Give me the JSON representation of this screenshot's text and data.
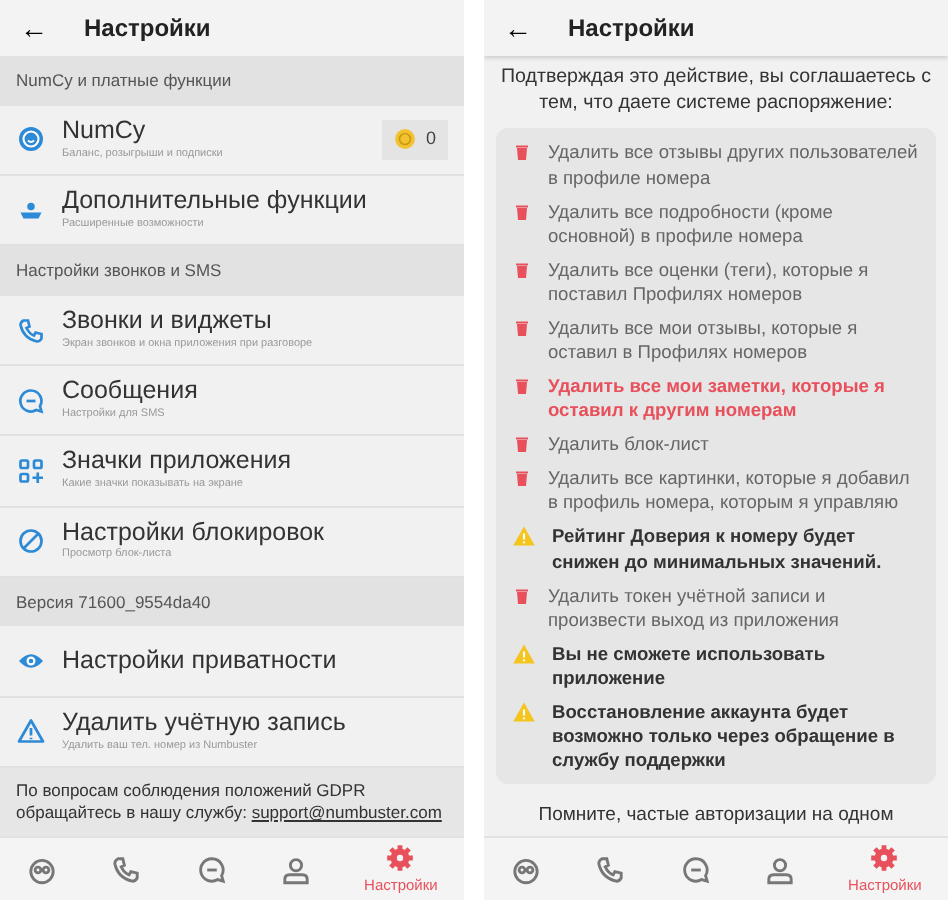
{
  "left": {
    "header": {
      "back": "←",
      "title": "Настройки"
    },
    "sections": [
      {
        "kind": "label",
        "text": "NumCy и платные функции"
      },
      {
        "kind": "row",
        "title": "NumCy",
        "subtitle": "Баланс, розыгрыши и подписки",
        "badge": "0"
      },
      {
        "kind": "row",
        "title": "Дополнительные функции",
        "subtitle": "Расширенные возможности"
      },
      {
        "kind": "label",
        "text": "Настройки звонков и SMS"
      },
      {
        "kind": "row",
        "title": "Звонки и виджеты",
        "subtitle": "Экран звонков и окна приложения при разговоре"
      },
      {
        "kind": "row",
        "title": "Сообщения",
        "subtitle": "Настройки для SMS"
      },
      {
        "kind": "row",
        "title": "Значки приложения",
        "subtitle": "Какие значки показывать на экране"
      },
      {
        "kind": "row",
        "title": "Настройки блокировок",
        "subtitle": "Просмотр блок-листа"
      },
      {
        "kind": "label",
        "text": "Версия 71600_9554da40"
      },
      {
        "kind": "row",
        "title": "Настройки приватности"
      },
      {
        "kind": "row",
        "title": "Удалить учётную запись",
        "subtitle": "Удалить ваш тел. номер из Numbuster"
      },
      {
        "kind": "note",
        "text": "По вопросам соблюдения положений GDPR обращайтесь в нашу службу:",
        "link": "support@numbuster.com"
      }
    ],
    "nav": [
      {
        "kind": "owl",
        "selected": false
      },
      {
        "kind": "phone",
        "selected": false
      },
      {
        "kind": "chat",
        "selected": false
      },
      {
        "kind": "person",
        "selected": false
      },
      {
        "kind": "gear",
        "label": "Настройки",
        "selected": true
      }
    ]
  },
  "right": {
    "header": {
      "back": "←",
      "title": "Настройки"
    },
    "intro": "Подтверждая это действие, вы соглашаетесь с тем, что даете системе распоряжение:",
    "items": [
      {
        "kind": "delete",
        "text": "Удалить все отзывы других пользователей в профиле номера",
        "highlighted": false
      },
      {
        "kind": "delete",
        "text": "Удалить все подробности (кроме основной) в профиле номера",
        "highlighted": false
      },
      {
        "kind": "delete",
        "text": "Удалить все оценки (теги), которые я поставил Профилях номеров",
        "highlighted": false
      },
      {
        "kind": "delete",
        "text": "Удалить все мои отзывы, которые я оставил в Профилях номеров",
        "highlighted": false
      },
      {
        "kind": "delete",
        "text": "Удалить все мои заметки, которые я оставил к другим номерам",
        "highlighted": true
      },
      {
        "kind": "delete",
        "text": "Удалить блок-лист",
        "highlighted": false
      },
      {
        "kind": "delete",
        "text": "Удалить все картинки, которые я добавил в профиль номера, которым я управляю",
        "highlighted": false
      },
      {
        "kind": "warning",
        "text": "Рейтинг Доверия к номеру будет снижен до минимальных значений."
      },
      {
        "kind": "delete",
        "text": "Удалить токен учётной записи и произвести выход из приложения",
        "highlighted": false
      },
      {
        "kind": "warning",
        "text": "Вы не сможете использовать приложение"
      },
      {
        "kind": "warning",
        "text": "Восстановление аккаунта будет возможно только через обращение в службу поддержки"
      }
    ],
    "footer": "Помните, частые авторизации на одном",
    "nav": [
      {
        "kind": "owl",
        "selected": false
      },
      {
        "kind": "phone",
        "selected": false
      },
      {
        "kind": "chat",
        "selected": false
      },
      {
        "kind": "person",
        "selected": false
      },
      {
        "kind": "gear",
        "label": "Настройки",
        "selected": true
      }
    ]
  }
}
